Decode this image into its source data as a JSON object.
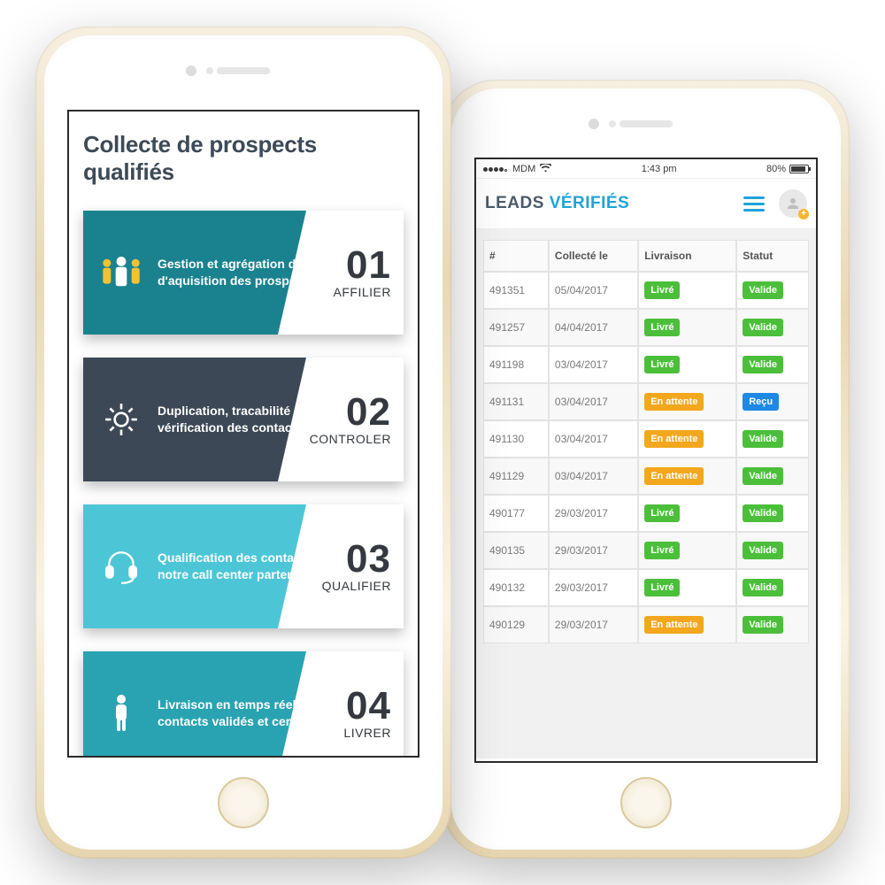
{
  "left": {
    "title": "Collecte de prospects qualifiés",
    "steps": [
      {
        "num": "01",
        "label": "AFFILIER",
        "text": "Gestion et agrégation des sources d'aquisition des prospects"
      },
      {
        "num": "02",
        "label": "CONTROLER",
        "text": "Duplication, tracabilité et vérification des contacts"
      },
      {
        "num": "03",
        "label": "QUALIFIER",
        "text": "Qualification des contacts via notre call center partenaire"
      },
      {
        "num": "04",
        "label": "LIVRER",
        "text": "Livraison en temps réel de contacts validés et certifiés"
      }
    ]
  },
  "right": {
    "status": {
      "carrier": "MDM",
      "time": "1:43 pm",
      "battery": "80%"
    },
    "brand": {
      "word1": "LEADS",
      "word2": "VÉRIFIÉS"
    },
    "columns": {
      "c0": "#",
      "c1": "Collecté le",
      "c2": "Livraison",
      "c3": "Statut"
    },
    "badges": {
      "livre": "Livré",
      "attente": "En attente",
      "valide": "Valide",
      "recu": "Reçu"
    },
    "rows": [
      {
        "id": "491351",
        "date": "05/04/2017",
        "liv": "livre",
        "stat": "valide"
      },
      {
        "id": "491257",
        "date": "04/04/2017",
        "liv": "livre",
        "stat": "valide"
      },
      {
        "id": "491198",
        "date": "03/04/2017",
        "liv": "livre",
        "stat": "valide"
      },
      {
        "id": "491131",
        "date": "03/04/2017",
        "liv": "attente",
        "stat": "recu"
      },
      {
        "id": "491130",
        "date": "03/04/2017",
        "liv": "attente",
        "stat": "valide"
      },
      {
        "id": "491129",
        "date": "03/04/2017",
        "liv": "attente",
        "stat": "valide"
      },
      {
        "id": "490177",
        "date": "29/03/2017",
        "liv": "livre",
        "stat": "valide"
      },
      {
        "id": "490135",
        "date": "29/03/2017",
        "liv": "livre",
        "stat": "valide"
      },
      {
        "id": "490132",
        "date": "29/03/2017",
        "liv": "livre",
        "stat": "valide"
      },
      {
        "id": "490129",
        "date": "29/03/2017",
        "liv": "attente",
        "stat": "valide"
      }
    ]
  }
}
